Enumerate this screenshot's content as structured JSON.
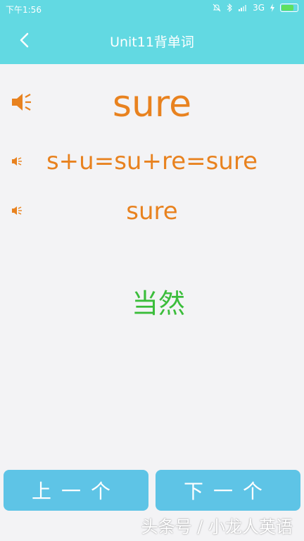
{
  "status_bar": {
    "time": "下午1:56",
    "network": "3G"
  },
  "header": {
    "title": "Unit11背单词"
  },
  "card": {
    "word": "sure",
    "breakdown": "s+u=su+re=sure",
    "phonetic": "sure",
    "meaning": "当然"
  },
  "footer": {
    "prev_label": "上一个",
    "next_label": "下一个"
  },
  "watermark": "头条号 / 小龙人英语",
  "colors": {
    "header": "#62d9e2",
    "word": "#e8821f",
    "meaning": "#3bbd3b",
    "button": "#5ec4e6"
  }
}
